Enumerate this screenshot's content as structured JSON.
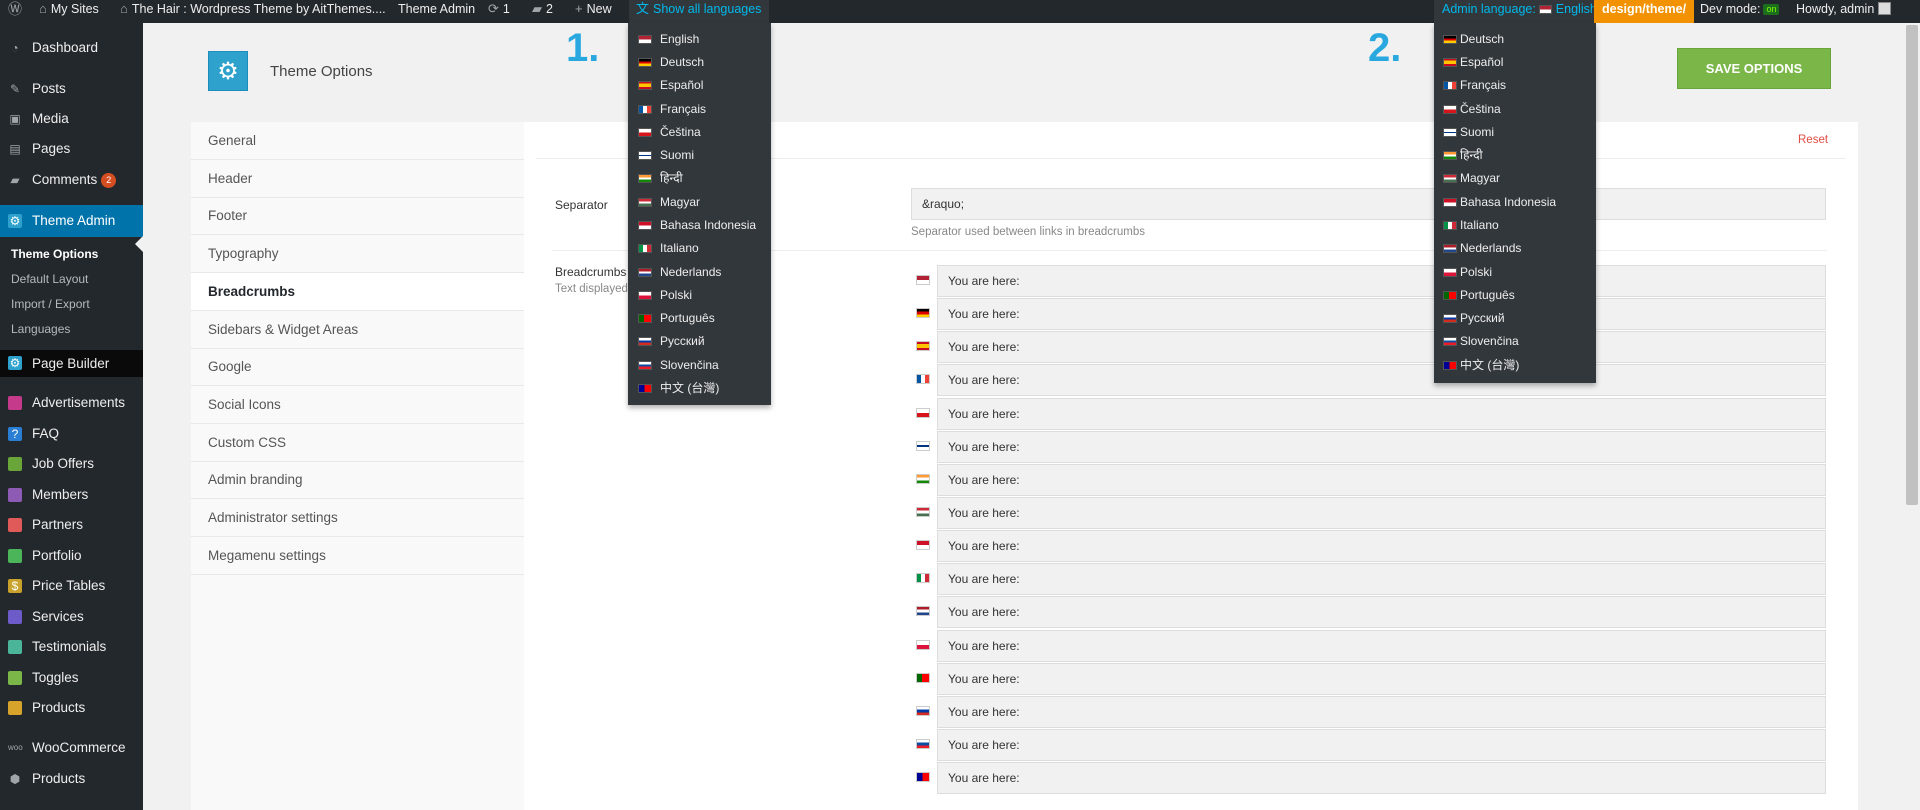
{
  "adminbar": {
    "my_sites": "My Sites",
    "site_name": "The Hair : Wordpress Theme by AitThemes....",
    "theme_admin": "Theme Admin",
    "updates": "1",
    "comments": "2",
    "new": "New",
    "show_all_languages": "Show all languages",
    "admin_language_label": "Admin language:",
    "admin_language_value": "English",
    "path_badge": "design/theme/",
    "dev_mode": "Dev mode:",
    "dev_mode_state": "on",
    "howdy": "Howdy, admin"
  },
  "sidebar": {
    "dashboard": "Dashboard",
    "posts": "Posts",
    "media": "Media",
    "pages": "Pages",
    "comments": "Comments",
    "comments_count": "2",
    "theme_admin": "Theme Admin",
    "sub": [
      "Theme Options",
      "Default Layout",
      "Import / Export",
      "Languages"
    ],
    "page_builder": "Page Builder",
    "items": [
      "Advertisements",
      "FAQ",
      "Job Offers",
      "Members",
      "Partners",
      "Portfolio",
      "Price Tables",
      "Services",
      "Testimonials",
      "Toggles",
      "Products"
    ],
    "woocommerce": "WooCommerce",
    "products": "Products"
  },
  "header": {
    "title": "Theme Options",
    "save": "SAVE OPTIONS",
    "step1": "1.",
    "step2": "2."
  },
  "tabs": [
    "General",
    "Header",
    "Footer",
    "Typography",
    "Breadcrumbs",
    "Sidebars & Widget Areas",
    "Google",
    "Social Icons",
    "Custom CSS",
    "Admin branding",
    "Administrator settings",
    "Megamenu settings"
  ],
  "main": {
    "reset": "Reset",
    "separator_label": "Separator",
    "separator_value": "&raquo;",
    "separator_help": "Separator used between links in breadcrumbs",
    "breadcrumbs_label": "Breadcrumbs",
    "breadcrumbs_help": "Text displayed",
    "youarehere": [
      "You are here:",
      "You are here:",
      "You are here:",
      "You are here:",
      "You are here:",
      "You are here:",
      "You are here:",
      "You are here:",
      "You are here:",
      "You are here:",
      "You are here:",
      "You are here:",
      "You are here:",
      "You are here:",
      "You are here:",
      "You are here:"
    ]
  },
  "dropdown1": [
    "English",
    "Deutsch",
    "Español",
    "Français",
    "Čeština",
    "Suomi",
    "हिन्दी",
    "Magyar",
    "Bahasa Indonesia",
    "Italiano",
    "Nederlands",
    "Polski",
    "Português",
    "Русский",
    "Slovenčina",
    "中文 (台灣)"
  ],
  "dropdown2": [
    "Deutsch",
    "Español",
    "Français",
    "Čeština",
    "Suomi",
    "हिन्दी",
    "Magyar",
    "Bahasa Indonesia",
    "Italiano",
    "Nederlands",
    "Polski",
    "Português",
    "Русский",
    "Slovenčina",
    "中文 (台灣)"
  ],
  "colors": {
    "accent": "#0073aa",
    "save": "#7ab648",
    "step": "#29a8e0",
    "badge_orange": "#f39200"
  }
}
